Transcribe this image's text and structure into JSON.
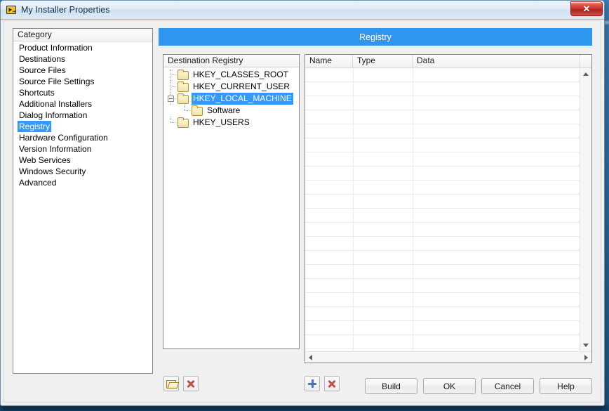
{
  "window": {
    "title": "My Installer Properties",
    "icon": "labview-installer-icon",
    "close_label": "✕"
  },
  "category": {
    "header": "Category",
    "items": [
      {
        "label": "Product Information",
        "selected": false
      },
      {
        "label": "Destinations",
        "selected": false
      },
      {
        "label": "Source Files",
        "selected": false
      },
      {
        "label": "Source File Settings",
        "selected": false
      },
      {
        "label": "Shortcuts",
        "selected": false
      },
      {
        "label": "Additional Installers",
        "selected": false
      },
      {
        "label": "Dialog Information",
        "selected": false
      },
      {
        "label": "Registry",
        "selected": true
      },
      {
        "label": "Hardware Configuration",
        "selected": false
      },
      {
        "label": "Version Information",
        "selected": false
      },
      {
        "label": "Web Services",
        "selected": false
      },
      {
        "label": "Windows Security",
        "selected": false
      },
      {
        "label": "Advanced",
        "selected": false
      }
    ]
  },
  "banner": {
    "title": "Registry"
  },
  "tree": {
    "header": "Destination Registry",
    "nodes": [
      {
        "label": "HKEY_CLASSES_ROOT",
        "level": 1,
        "selected": false,
        "expandable": false
      },
      {
        "label": "HKEY_CURRENT_USER",
        "level": 1,
        "selected": false,
        "expandable": false
      },
      {
        "label": "HKEY_LOCAL_MACHINE",
        "level": 1,
        "selected": true,
        "expandable": true,
        "expanded": true
      },
      {
        "label": "Software",
        "level": 2,
        "selected": false,
        "expandable": false
      },
      {
        "label": "HKEY_USERS",
        "level": 1,
        "selected": false,
        "expandable": false
      }
    ]
  },
  "listview": {
    "columns": [
      "Name",
      "Type",
      "Data"
    ],
    "rows": []
  },
  "tree_toolbar": [
    {
      "icon": "open-folder-icon",
      "name": "browse-registry-key-button"
    },
    {
      "icon": "delete-x-icon",
      "name": "delete-registry-key-button"
    }
  ],
  "list_toolbar": [
    {
      "icon": "plus-icon",
      "name": "add-registry-value-button"
    },
    {
      "icon": "delete-x-icon",
      "name": "delete-registry-value-button"
    }
  ],
  "dialog_buttons": [
    {
      "label": "Build",
      "name": "build-button"
    },
    {
      "label": "OK",
      "name": "ok-button"
    },
    {
      "label": "Cancel",
      "name": "cancel-button"
    },
    {
      "label": "Help",
      "name": "help-button"
    }
  ],
  "colors": {
    "accent_banner": "#2f96f0",
    "selection": "#3399ff",
    "close_red": "#c3322a",
    "folder_yellow": "#f2e0a4",
    "delete_red": "#c0504d",
    "plus_blue": "#4a6fd4"
  }
}
